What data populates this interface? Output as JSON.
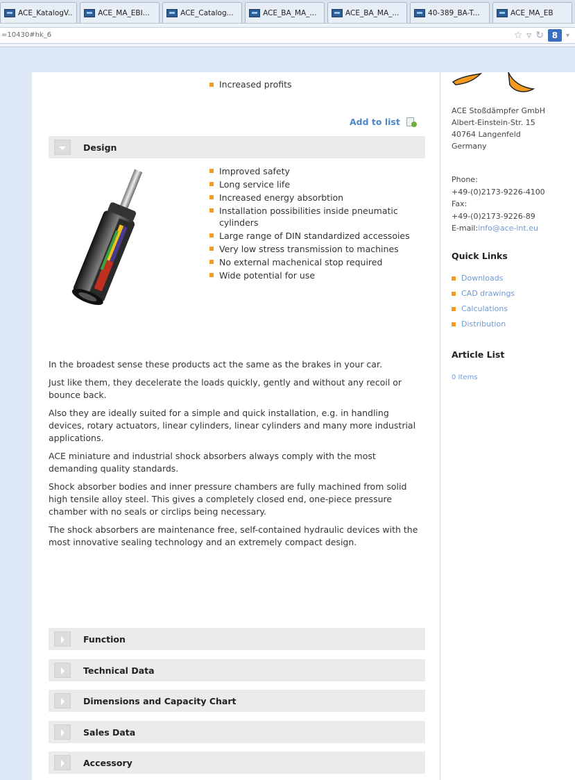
{
  "browser": {
    "tabs": [
      {
        "label": "ACE_KatalogV..."
      },
      {
        "label": "ACE_MA_EBI..."
      },
      {
        "label": "ACE_Catalog..."
      },
      {
        "label": "ACE_BA_MA_..."
      },
      {
        "label": "ACE_BA_MA_..."
      },
      {
        "label": "40-389_BA-T..."
      },
      {
        "label": "ACE_MA_EB"
      }
    ],
    "url": "=10430#hk_6",
    "google_button_label": "8"
  },
  "main": {
    "top_bullet": "Increased profits",
    "add_to_list_label": "Add to list",
    "design_section": {
      "title": "Design",
      "bullets": [
        "Improved safety",
        "Long service life",
        "Increased energy absorbtion",
        "Installation possibilities inside pneumatic cylinders",
        "Large range of DIN standardized accessoies",
        "Very low stress transmission to machines",
        "No external machenical stop required",
        "Wide potential for use"
      ]
    },
    "description": [
      "In the broadest sense these products act the same as the brakes in your car.",
      "Just like them, they decelerate the loads quickly, gently and without any recoil or bounce back.",
      "Also they are ideally suited for a simple and quick installation, e.g. in handling devices, rotary actuators, linear cylinders, linear cylinders and many more industrial applications.",
      "ACE miniature and industrial shock absorbers always comply with the most demanding quality standards.",
      "Shock absorber bodies and inner pressure chambers are fully machined from solid high tensile alloy steel. This gives a completely closed end, one-piece pressure chamber with no seals or circlips being necessary.",
      "The shock absorbers are maintenance free, self-contained hydraulic devices with the most innovative sealing technology and an extremely compact design."
    ],
    "sections": [
      {
        "title": "Function"
      },
      {
        "title": "Technical Data"
      },
      {
        "title": "Dimensions and Capacity Chart"
      },
      {
        "title": "Sales Data"
      },
      {
        "title": "Accessory"
      }
    ]
  },
  "sidebar": {
    "address": [
      "ACE Stoßdämpfer GmbH",
      "Albert-Einstein-Str. 15",
      "40764 Langenfeld",
      "Germany"
    ],
    "phone_label": "Phone:",
    "phone": "+49-(0)2173-9226-4100",
    "fax_label": "Fax:",
    "fax": "+49-(0)2173-9226-89",
    "email_label": "E-mail:",
    "email": "info@ace-int.eu",
    "quick_links_title": "Quick Links",
    "quick_links": [
      {
        "label": "Downloads"
      },
      {
        "label": "CAD drawings"
      },
      {
        "label": "Calculations"
      },
      {
        "label": "Distribution"
      }
    ],
    "article_list_title": "Article List",
    "article_list_count": "0 Items"
  },
  "colors": {
    "accent_orange": "#f39a1f",
    "link_blue": "#4b87c9",
    "accordion_bg": "#ebebeb"
  }
}
